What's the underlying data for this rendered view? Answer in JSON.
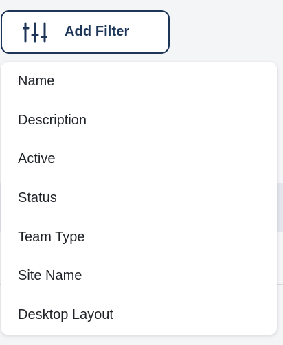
{
  "filter_button": {
    "label": "Add Filter",
    "icon": "sliders-icon"
  },
  "menu": {
    "items": [
      {
        "label": "Name"
      },
      {
        "label": "Description"
      },
      {
        "label": "Active"
      },
      {
        "label": "Status"
      },
      {
        "label": "Team Type"
      },
      {
        "label": "Site Name"
      },
      {
        "label": "Desktop Layout"
      }
    ]
  },
  "colors": {
    "accent": "#1d3557",
    "text": "#1f2328",
    "menu_background": "#ffffff"
  }
}
